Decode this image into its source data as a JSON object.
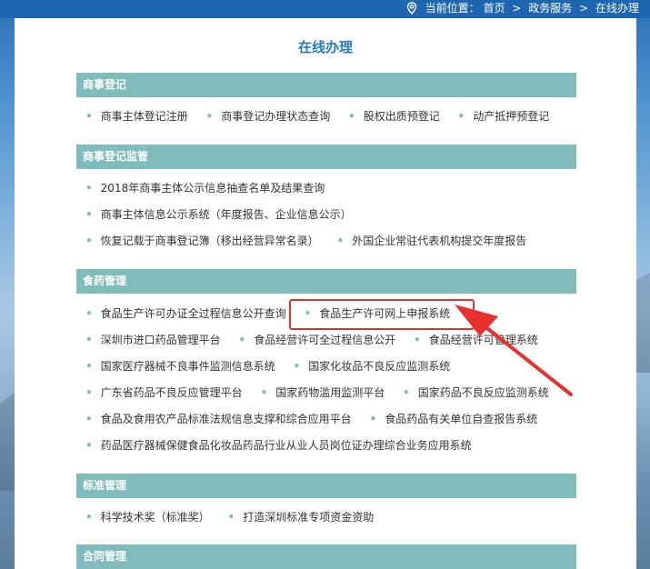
{
  "breadcrumb": {
    "label": "当前位置：",
    "items": [
      "首页",
      "政务服务",
      "在线办理"
    ],
    "separator": ">"
  },
  "title": "在线办理",
  "sections": [
    {
      "heading": "商事登记",
      "rows": [
        [
          "商事主体登记注册",
          "商事登记办理状态查询",
          "股权出质预登记",
          "动产抵押预登记"
        ]
      ]
    },
    {
      "heading": "商事登记监管",
      "rows": [
        [
          "2018年商事主体公示信息抽查名单及结果查询"
        ],
        [
          "商事主体信息公示系统（年度报告、企业信息公示）"
        ],
        [
          "恢复记载于商事登记簿（移出经营异常名录）",
          "外国企业常驻代表机构提交年度报告"
        ]
      ]
    },
    {
      "heading": "食药管理",
      "rows": [
        [
          "食品生产许可办证全过程信息公开查询",
          "食品生产许可网上申报系统"
        ],
        [
          "深圳市进口药品管理平台",
          "食品经营许可全过程信息公开",
          "食品经营许可管理系统"
        ],
        [
          "国家医疗器械不良事件监测信息系统",
          "国家化妆品不良反应监测系统"
        ],
        [
          "广东省药品不良反应管理平台",
          "国家药物滥用监测平台",
          "国家药品不良反应监测系统"
        ],
        [
          "食品及食用农产品标准法规信息支撑和综合应用平台",
          "食品药品有关单位自查报告系统"
        ],
        [
          "药品医疗器械保健食品化妆品药品行业从业人员岗位证办理综合业务应用系统"
        ]
      ]
    },
    {
      "heading": "标准管理",
      "rows": [
        [
          "科学技术奖（标准奖）",
          "打造深圳标准专项资金资助"
        ]
      ]
    },
    {
      "heading": "合同管理",
      "rows": []
    }
  ],
  "colors": {
    "section_header_bg": "#7fbcbb",
    "title_color": "#2a7ab8",
    "highlight_border": "#e8302d",
    "topbar_bg": "#1f66b0"
  },
  "icons": {
    "breadcrumb": "location-pin-icon",
    "bullet": "dot-bullet-icon",
    "annotation": "red-arrow-icon"
  }
}
